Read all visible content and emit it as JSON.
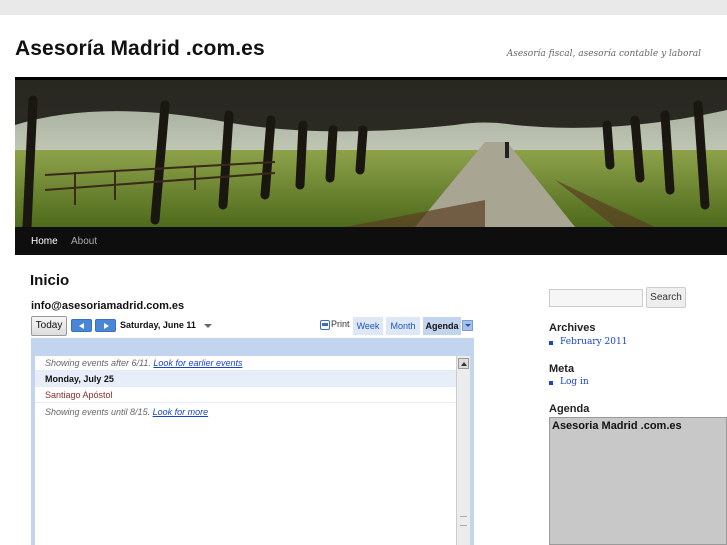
{
  "site": {
    "title": "Asesoría Madrid .com.es",
    "tagline": "Asesoría fiscal, asesoría contable y laboral"
  },
  "nav": {
    "items": [
      {
        "label": "Home",
        "active": true
      },
      {
        "label": "About",
        "active": false
      }
    ]
  },
  "main": {
    "page_title": "Inicio",
    "calendar": {
      "name": "info@asesoriamadrid.com.es",
      "today_label": "Today",
      "current_date": "Saturday, June 11",
      "print_label": "Print",
      "tabs": [
        {
          "label": "Week",
          "active": false
        },
        {
          "label": "Month",
          "active": false
        },
        {
          "label": "Agenda",
          "active": true
        }
      ],
      "showing_after_text": "Showing events after 6/11.",
      "earlier_link": "Look for earlier events",
      "day_header": "Monday, July 25",
      "event_title": "Santiago Apóstol",
      "showing_until_text": "Showing events until 8/15.",
      "more_link": "Look for more"
    }
  },
  "sidebar": {
    "search_placeholder": "",
    "search_button": "Search",
    "archives_title": "Archives",
    "archives_items": [
      "February 2011"
    ],
    "meta_title": "Meta",
    "meta_items": [
      "Log in"
    ],
    "agenda_title": "Agenda",
    "agenda_widget_name": "Asesoria Madrid .com.es"
  },
  "colors": {
    "nav_bar": "#0e0e0e",
    "link": "#1a44c4",
    "calendar_frame": "#c3d4ee",
    "event_text": "#8b2b2b"
  }
}
